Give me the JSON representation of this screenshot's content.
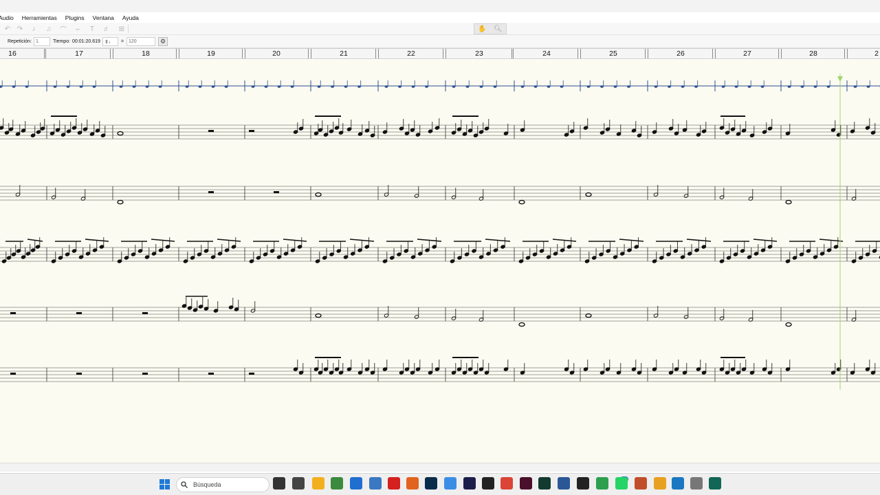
{
  "menu": [
    "Audio",
    "Herramientas",
    "Plugins",
    "Ventana",
    "Ayuda"
  ],
  "toolbar_icons": [
    "undo-icon",
    "redo-icon",
    "note-input-icon",
    "slur-icon",
    "tie-icon",
    "beam-icon",
    "grace-icon",
    "text-icon",
    "chord-icon",
    "add-icon"
  ],
  "right_tools": [
    "pan-hand-icon",
    "zoom-icon"
  ],
  "playback": {
    "repeat_label": "Repetición:",
    "repeat_value": "1",
    "tempo_label": "Tiempo:",
    "time_value": "00:01:20.619",
    "equals": "=",
    "bpm_value": "120"
  },
  "measures": [
    "16",
    "17",
    "18",
    "19",
    "20",
    "21",
    "22",
    "23",
    "24",
    "25",
    "26",
    "27",
    "28",
    "2"
  ],
  "playhead_color": "#9fd66a",
  "taskbar": {
    "search_placeholder": "Búsqueda",
    "notification_badge": "20",
    "apps": [
      "windows-start-icon",
      "task-view-icon",
      "terminal-icon",
      "file-explorer-icon",
      "calculator-icon",
      "edge-icon",
      "calendar-icon",
      "acrobat-icon",
      "firefox-icon",
      "photoshop-icon",
      "cloud-icon",
      "audition-icon",
      "notch-icon",
      "chrome-icon",
      "indesign-icon",
      "git-bash-icon",
      "powershell-icon",
      "cmd-icon",
      "chrome-profile-icon",
      "whatsapp-icon",
      "chrome-dev-icon",
      "chrome-canary-icon",
      "musescore-icon",
      "settings-icon",
      "dev-terminal-icon"
    ]
  }
}
